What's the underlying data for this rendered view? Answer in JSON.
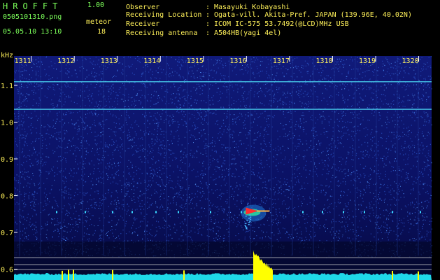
{
  "app": {
    "title": "HROFFT",
    "version": "1.00"
  },
  "file": {
    "name": "0505101310.png",
    "datetime": "05.05.10 13:10"
  },
  "meteor": {
    "label": "meteor",
    "count": "18"
  },
  "info": [
    {
      "key": "Observer",
      "value": "Masayuki Kobayashi"
    },
    {
      "key": "Receiving Location",
      "value": "Ogata-vill. Akita-Pref. JAPAN (139.96E, 40.02N)"
    },
    {
      "key": "Receiver",
      "value": "ICOM IC-575 53.7492(@LCD)MHz USB"
    },
    {
      "key": "Receiving antenna",
      "value": "A504HB(yagi 4el)"
    }
  ],
  "colors": {
    "label_green": "#7CFF5A",
    "label_yellow": "#FFF15A",
    "background": "#000000",
    "signal": "#FFFF00",
    "noise_floor": "#1FD8E8"
  },
  "chart_data": {
    "type": "heatmap",
    "title": "",
    "ylabel": "kHz",
    "xlabel": "",
    "x_ticks": [
      "1311",
      "1312",
      "1313",
      "1314",
      "1315",
      "1316",
      "1317",
      "1318",
      "1319",
      "1320"
    ],
    "y_ticks": [
      "1.1",
      "1.0",
      "0.9",
      "0.8",
      "0.7",
      "0.6"
    ],
    "y_tick_values": [
      1.1,
      1.0,
      0.9,
      0.8,
      0.7,
      0.6
    ],
    "ylim": [
      0.58,
      1.18
    ],
    "xlim": [
      1310.6,
      1320.3
    ],
    "carriers_khz": [
      1.11,
      1.035
    ],
    "meteor_echo": {
      "time": "1316",
      "freq_khz": 0.76
    }
  }
}
